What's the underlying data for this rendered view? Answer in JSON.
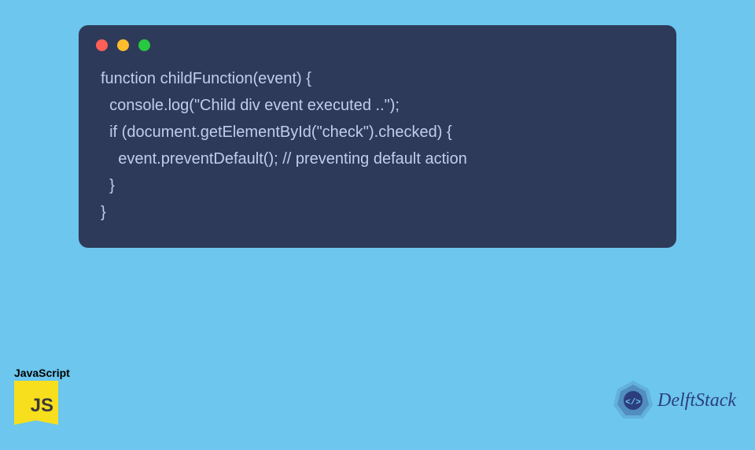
{
  "code": {
    "line1": "function childFunction(event) {",
    "line2": "  console.log(\"Child div event executed ..\");",
    "line3": "  if (document.getElementById(\"check\").checked) {",
    "line4": "    event.preventDefault(); // preventing default action",
    "line5": "  }",
    "line6": "}"
  },
  "jsBadge": {
    "label": "JavaScript",
    "logoText": "JS"
  },
  "brand": {
    "name": "DelftStack"
  }
}
